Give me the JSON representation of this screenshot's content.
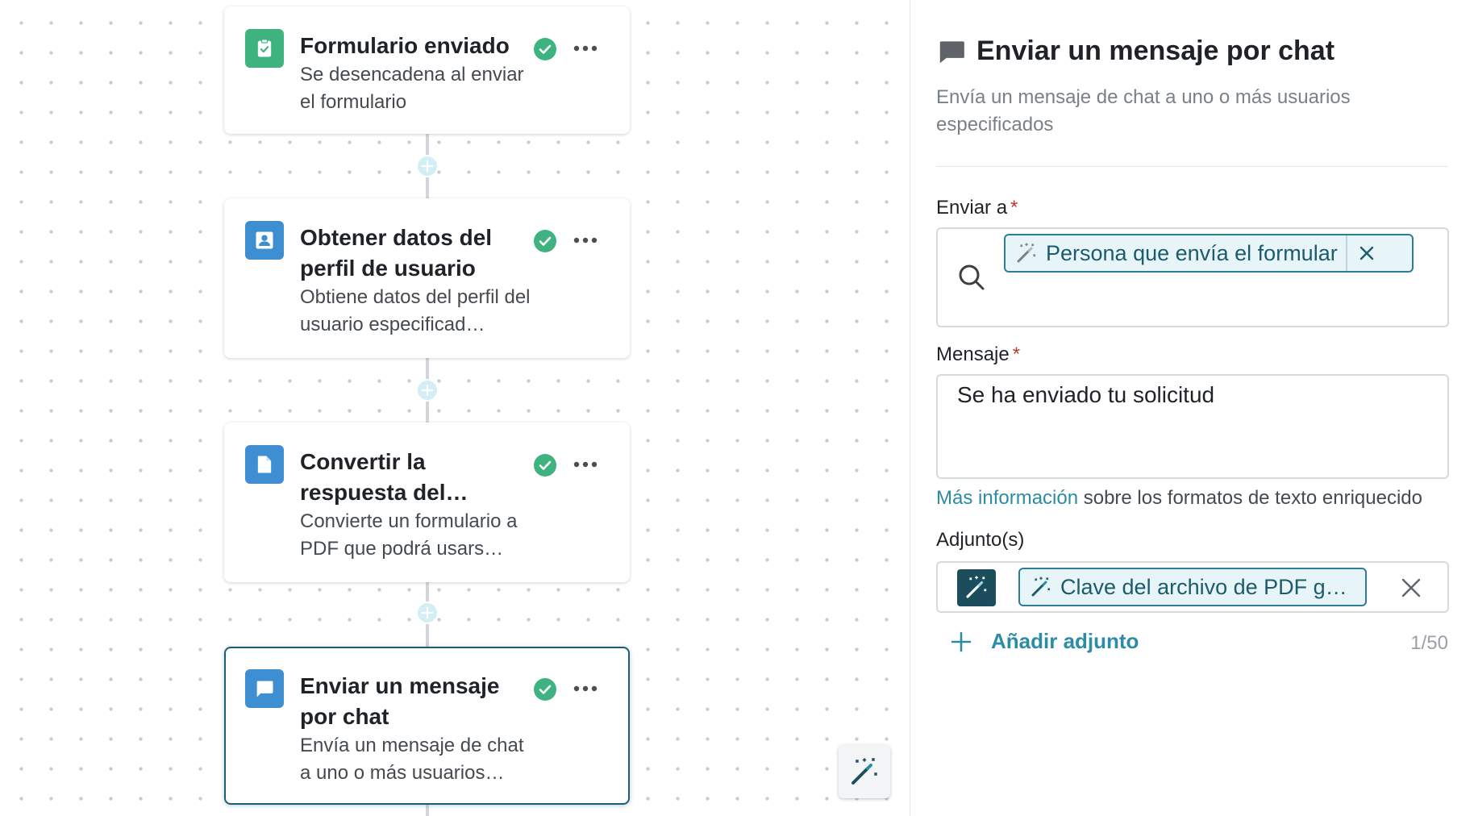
{
  "workflow": {
    "steps": [
      {
        "title": "Formulario enviado",
        "description": "Se desencadena al enviar el formulario",
        "icon": "form-check-icon",
        "icon_color": "#3fb37f",
        "status": "success"
      },
      {
        "title": "Obtener datos del perfil de usuario",
        "description": "Obtiene datos del perfil del usuario especificad…",
        "icon": "person-icon",
        "icon_color": "#3d8fd1",
        "status": "success"
      },
      {
        "title": "Convertir la respuesta del…",
        "description": "Convierte un formulario a PDF que podrá usars…",
        "icon": "document-icon",
        "icon_color": "#3d8fd1",
        "status": "success"
      },
      {
        "title": "Enviar un mensaje por chat",
        "description": "Envía un mensaje de chat a uno o más usuarios…",
        "icon": "chat-icon",
        "icon_color": "#3d8fd1",
        "status": "success",
        "selected": true
      }
    ]
  },
  "panel": {
    "title": "Enviar un mensaje por chat",
    "description": "Envía un mensaje de chat a uno o más usuarios especificados",
    "send_to": {
      "label": "Enviar a",
      "required_mark": "*",
      "chip_label": "Persona que envía el formular"
    },
    "message": {
      "label": "Mensaje",
      "required_mark": "*",
      "value": "Se ha enviado tu solicitud"
    },
    "help": {
      "link_text": "Más información",
      "rest_text": " sobre los formatos de texto enriquecido"
    },
    "attachments": {
      "label": "Adjunto(s)",
      "chip_label": "Clave del archivo de PDF g…",
      "add_label": "Añadir adjunto",
      "count": "1/50"
    }
  },
  "colors": {
    "accent": "#2b8ca6",
    "success": "#3fb37f",
    "selected_border": "#1e5d78",
    "required": "#c0392b"
  }
}
